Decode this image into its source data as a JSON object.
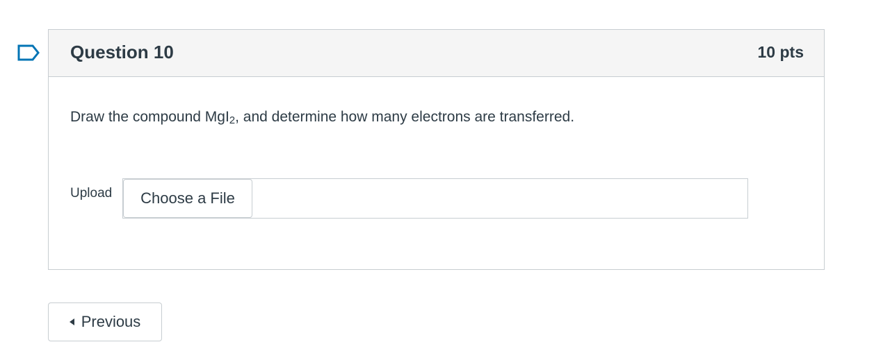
{
  "question": {
    "title": "Question 10",
    "points": "10 pts",
    "text_before": "Draw the compound MgI",
    "text_subscript": "2",
    "text_after": ", and determine how many electrons are transferred.",
    "upload_label": "Upload",
    "choose_file_label": "Choose a File"
  },
  "navigation": {
    "previous_label": "Previous"
  },
  "icons": {
    "flag": "bookmark-flag-icon",
    "previous": "caret-left-icon"
  },
  "colors": {
    "text": "#2d3b45",
    "flag": "#0374b5",
    "border": "#c7cdd1",
    "header_bg": "#f5f5f5"
  }
}
